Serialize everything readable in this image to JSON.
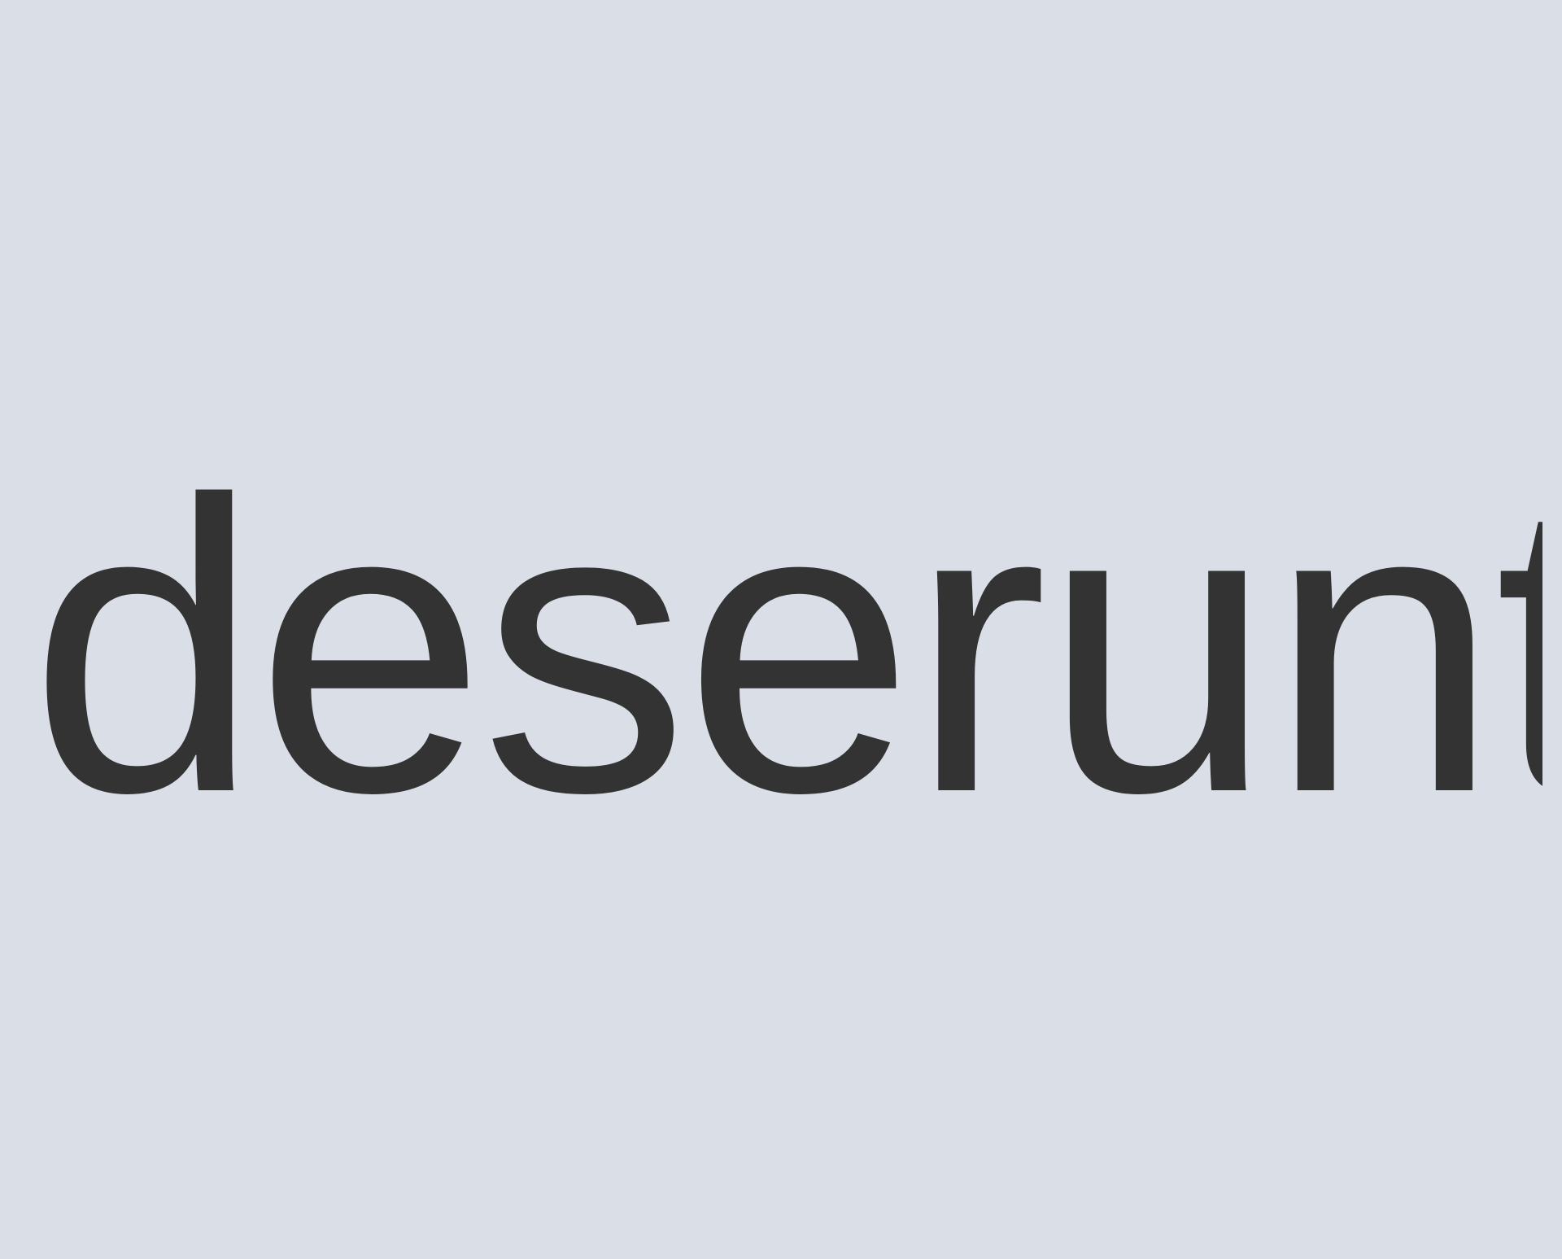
{
  "display": {
    "text": "deserunt",
    "text_color": "#333333",
    "background_color": "#d9dee7"
  }
}
